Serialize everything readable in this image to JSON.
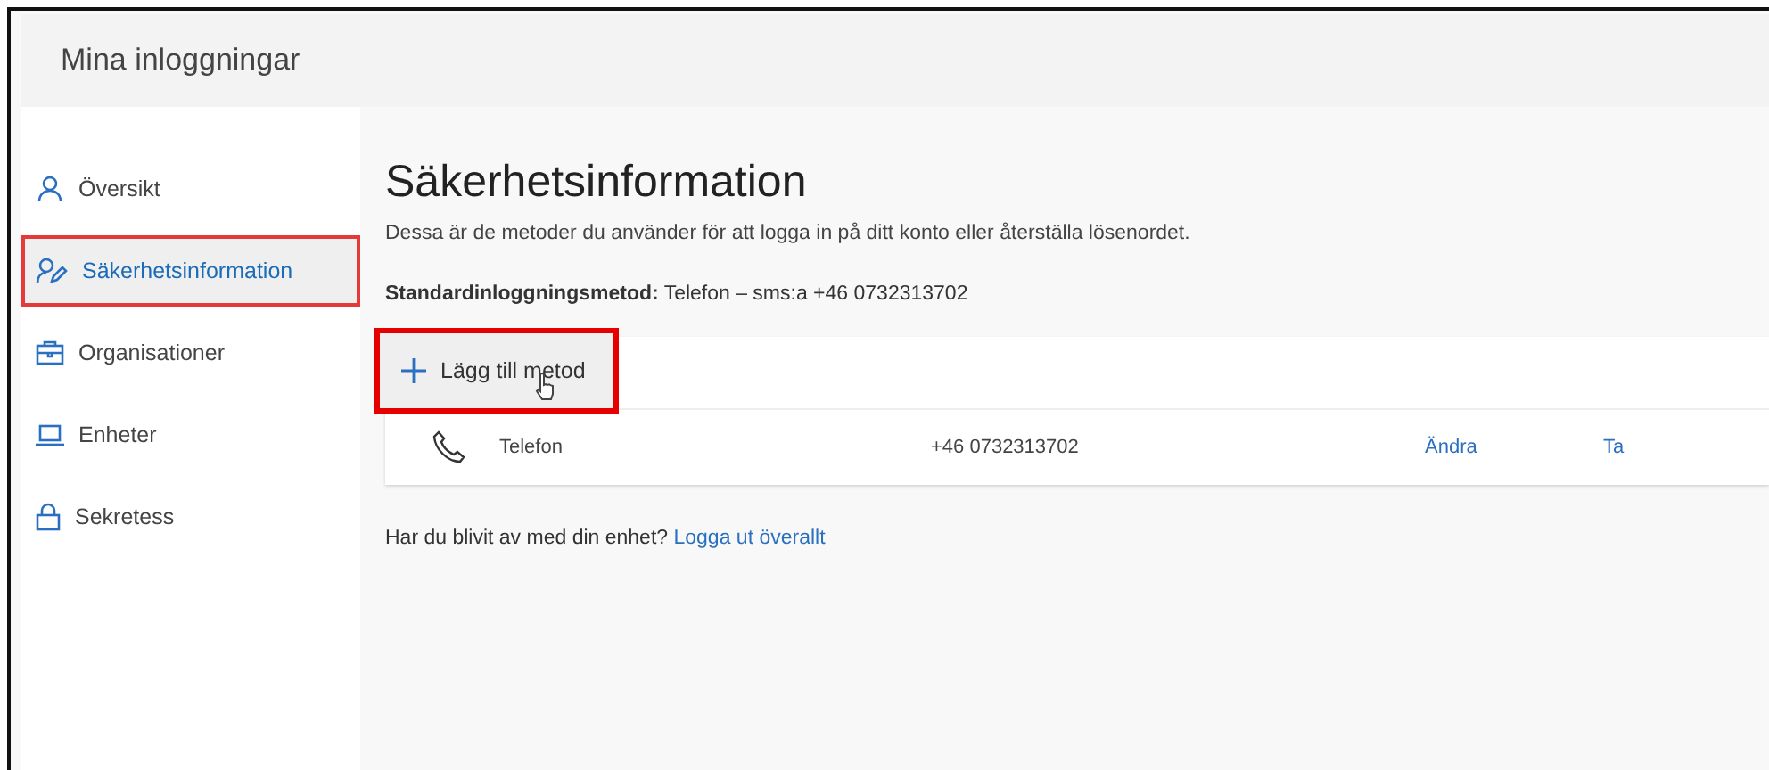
{
  "header": {
    "title": "Mina inloggningar"
  },
  "sidebar": {
    "items": [
      {
        "label": "Översikt",
        "selected": false,
        "highlighted": false
      },
      {
        "label": "Säkerhetsinformation",
        "selected": true,
        "highlighted": true
      },
      {
        "label": "Organisationer",
        "selected": false,
        "highlighted": false
      },
      {
        "label": "Enheter",
        "selected": false,
        "highlighted": false
      },
      {
        "label": "Sekretess",
        "selected": false,
        "highlighted": false
      }
    ]
  },
  "main": {
    "title": "Säkerhetsinformation",
    "description": "Dessa är de metoder du använder för att logga in på ditt konto eller återställa lösenordet.",
    "default_method": "**Standardinloggningsmetod:** Telefon – sms:a +46 0732313702",
    "add_button": {
      "label": "Lägg till metod",
      "highlighted": true
    },
    "methods": [
      {
        "type": "Telefon",
        "value": "+46 0732313702",
        "change": "Ändra",
        "delete": "Ta"
      }
    ],
    "lost_device": {
      "text": "Har du blivit av med din enhet?",
      "link": "Logga ut överallt"
    }
  }
}
